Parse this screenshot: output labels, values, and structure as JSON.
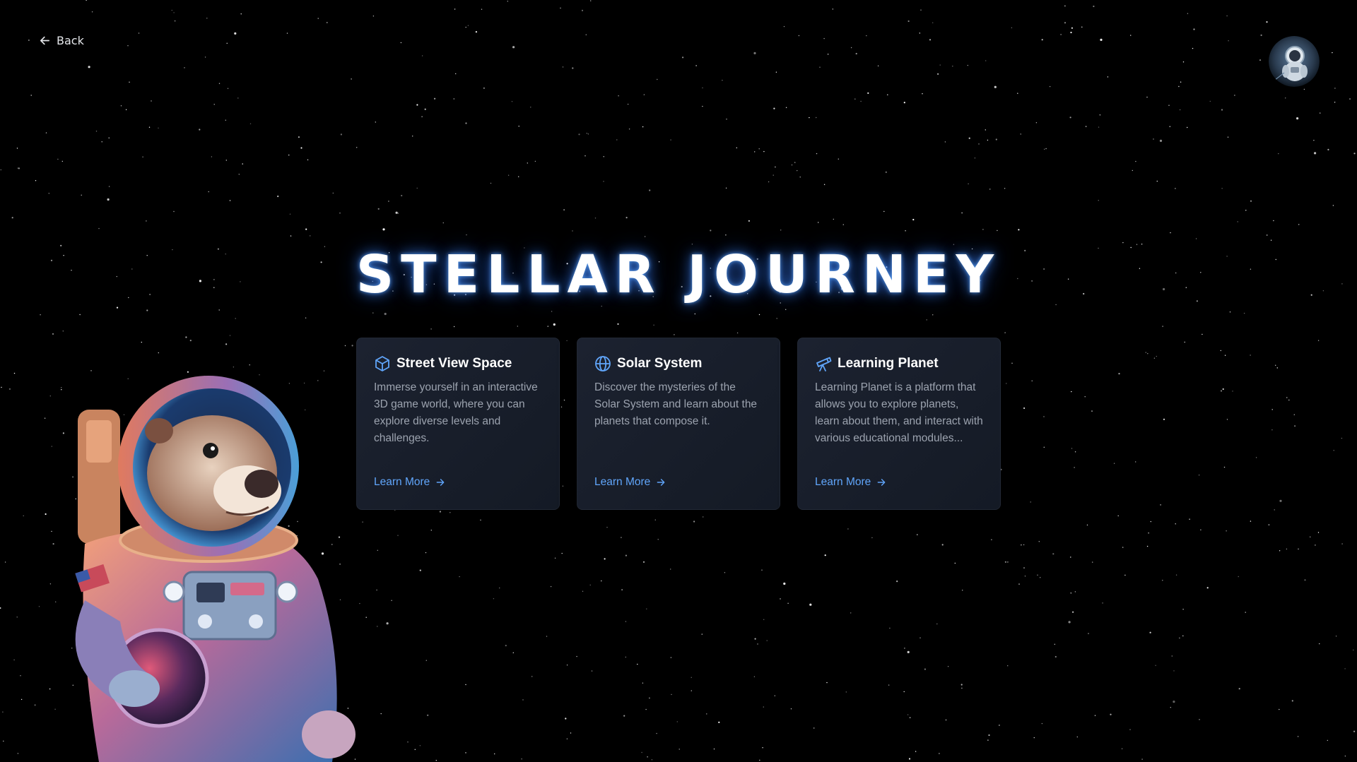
{
  "nav": {
    "back_label": "Back"
  },
  "hero": {
    "title": "STELLAR JOURNEY"
  },
  "cards": [
    {
      "icon": "cube-icon",
      "title": "Street View Space",
      "description": "Immerse yourself in an interactive 3D game world, where you can explore diverse levels and challenges.",
      "link_label": "Learn More"
    },
    {
      "icon": "globe-icon",
      "title": "Solar System",
      "description": "Discover the mysteries of the Solar System and learn about the planets that compose it.",
      "link_label": "Learn More"
    },
    {
      "icon": "telescope-icon",
      "title": "Learning Planet",
      "description": "Learning Planet is a platform that allows you to explore planets, learn about them, and interact with various educational modules...",
      "link_label": "Learn More"
    }
  ],
  "colors": {
    "background": "#000000",
    "accent": "#60a5fa",
    "card_bg": "#1a202c",
    "text_muted": "#9ca3af"
  }
}
